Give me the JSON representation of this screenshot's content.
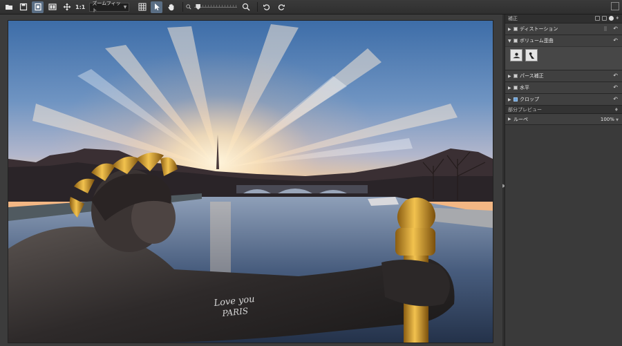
{
  "toolbar": {
    "ratio_label": "1:1",
    "zoom_mode": "ズームフィット"
  },
  "canvas": {
    "graffiti_line1": "Love you",
    "graffiti_line2": "PARIS"
  },
  "panel": {
    "title": "補正",
    "sections": [
      {
        "label": "ディストーション",
        "expanded": false,
        "checked": false
      },
      {
        "label": "ボリューム歪曲",
        "expanded": true,
        "checked": false
      },
      {
        "label": "パース補正",
        "expanded": false,
        "checked": false
      },
      {
        "label": "水平",
        "expanded": false,
        "checked": false
      },
      {
        "label": "クロップ",
        "expanded": false,
        "checked": true
      }
    ],
    "preview_header": "部分プレビュー",
    "loupe_label": "ルーペ",
    "loupe_value": "100%"
  },
  "icons": {
    "expanded": "▼",
    "collapsed": "▶",
    "undo": "↶"
  },
  "colors": {
    "accent": "#5a6e84",
    "panel_bg": "#3a3a3a",
    "canvas_bg": "#3c3c3c"
  }
}
